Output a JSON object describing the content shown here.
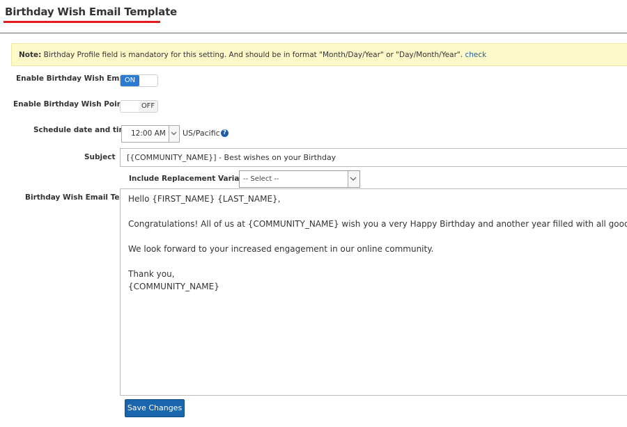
{
  "page": {
    "title": "Birthday Wish Email Template"
  },
  "note": {
    "bold": "Note:",
    "text": " Birthday Profile field is mandatory for this setting. And should be in format \"Month/Day/Year\" or \"Day/Month/Year\". ",
    "link": "check"
  },
  "settings": {
    "birthday_email": {
      "label": "Enable Birthday Wish Email",
      "state": "ON"
    },
    "birthday_points": {
      "label": "Enable Birthday Wish Points",
      "state": "OFF"
    },
    "schedule": {
      "label": "Schedule date and time",
      "time": "12:00 AM",
      "timezone": "US/Pacific",
      "help_icon": "question-circle-icon"
    },
    "subject": {
      "label": "Subject",
      "value": "[{COMMUNITY_NAME}] - Best wishes on your Birthday"
    },
    "replacement": {
      "label": "Include Replacement Variables:",
      "selected": "-- Select --"
    },
    "email_text": {
      "label": "Birthday Wish Email Text",
      "lines": [
        "Hello {FIRST_NAME} {LAST_NAME},",
        "Congratulations! All of us at {COMMUNITY_NAME} wish you a very Happy Birthday and another year filled with all good things!",
        "We look forward to your increased engagement in our online community.",
        "Thank you,",
        "{COMMUNITY_NAME}"
      ]
    }
  },
  "actions": {
    "save_label": "Save Changes"
  },
  "colors": {
    "accent_red": "#e21a22",
    "toggle_on": "#2b7bd3",
    "button_blue": "#1a66ad",
    "note_bg": "#fdf9c8"
  }
}
